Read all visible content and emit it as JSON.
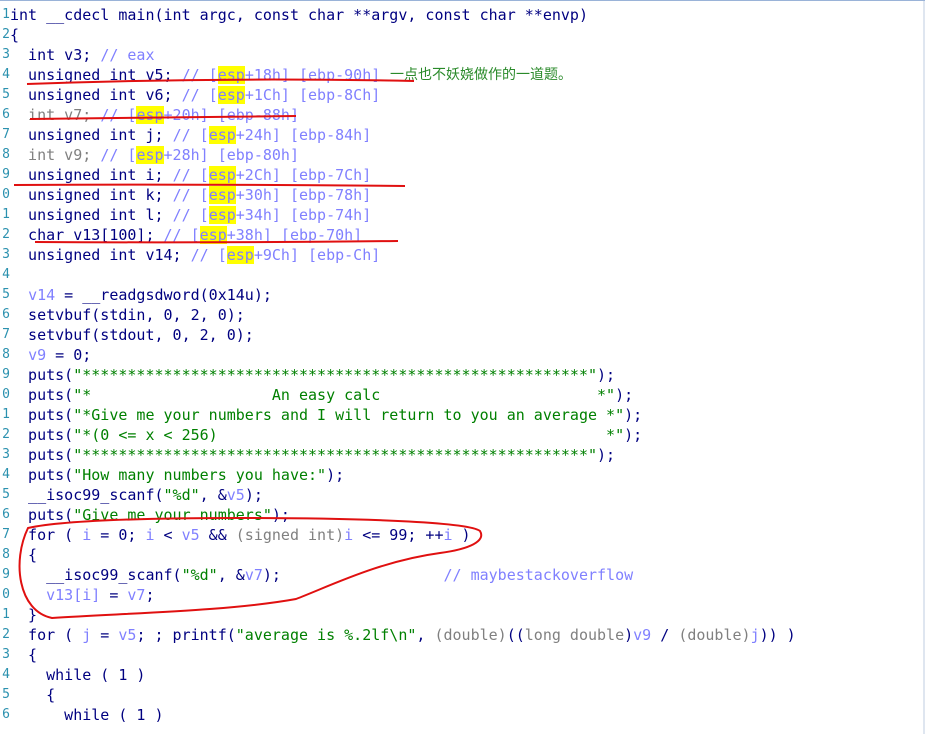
{
  "gutter": [
    "1",
    "2",
    "3",
    "4",
    "5",
    "6",
    "7",
    "8",
    "9",
    "0",
    "1",
    "2",
    "3",
    "4",
    "5",
    "6",
    "7",
    "8",
    "9",
    "0",
    "1",
    "2",
    "3",
    "4",
    "5",
    "6",
    "7",
    "8",
    "9",
    "0",
    "1",
    "2",
    "3",
    "4",
    "5",
    "6"
  ],
  "code": {
    "l1": "int __cdecl main(int argc, const char **argv, const char **envp)",
    "l2": "{",
    "l3a": "  int v3; ",
    "l3c": "// eax",
    "l4a": "  unsigned int v5; ",
    "l4c1": "// [",
    "l4h": "esp",
    "l4c2": "+18h] [ebp-90h]",
    "l5a": "  unsigned int v6; ",
    "l5c1": "// [",
    "l5h": "esp",
    "l5c2": "+1Ch] [ebp-8Ch]",
    "l6a": "  int v7; ",
    "l6c1": "// [",
    "l6h": "esp",
    "l6c2": "+20h] [ebp-88h]",
    "l7a": "  unsigned int j; ",
    "l7c1": "// [",
    "l7h": "esp",
    "l7c2": "+24h] [ebp-84h]",
    "l8a": "  int v9; ",
    "l8c1": "// [",
    "l8h": "esp",
    "l8c2": "+28h] [ebp-80h]",
    "l9a": "  unsigned int i; ",
    "l9c1": "// [",
    "l9h": "esp",
    "l9c2": "+2Ch] [ebp-7Ch]",
    "l10a": "  unsigned int k; ",
    "l10c1": "// [",
    "l10h": "esp",
    "l10c2": "+30h] [ebp-78h]",
    "l11a": "  unsigned int l; ",
    "l11c1": "// [",
    "l11h": "esp",
    "l11c2": "+34h] [ebp-74h]",
    "l12a": "  char v13[100]; ",
    "l12c1": "// [",
    "l12h": "esp",
    "l12c2": "+38h] [ebp-70h]",
    "l13a": "  unsigned int v14; ",
    "l13c1": "// [",
    "l13h": "esp",
    "l13c2": "+9Ch] [ebp-Ch]",
    "l15a": "  ",
    "l15v": "v14",
    "l15b": " = __readgsdword(0x14u);",
    "l16": "  setvbuf(stdin, 0, 2, 0);",
    "l17": "  setvbuf(stdout, 0, 2, 0);",
    "l18a": "  ",
    "l18v": "v9",
    "l18b": " = 0;",
    "l19a": "  puts(",
    "l19s": "\"********************************************************\"",
    "l19b": ");",
    "l20a": "  puts(",
    "l20s": "\"*                    An easy calc                        *\"",
    "l20b": ");",
    "l21a": "  puts(",
    "l21s": "\"*Give me your numbers and I will return to you an average *\"",
    "l21b": ");",
    "l22a": "  puts(",
    "l22s": "\"*(0 <= x < 256)                                           *\"",
    "l22b": ");",
    "l23a": "  puts(",
    "l23s": "\"********************************************************\"",
    "l23b": ");",
    "l24a": "  puts(",
    "l24s": "\"How many numbers you have:\"",
    "l24b": ");",
    "l25a": "  __isoc99_scanf(",
    "l25s": "\"%d\"",
    "l25b": ", &",
    "l25v": "v5",
    "l25c": ");",
    "l26a": "  puts(",
    "l26s": "\"Give me your numbers\"",
    "l26b": ");",
    "l27a": "  for ( ",
    "l27v1": "i",
    "l27b": " = 0; ",
    "l27v2": "i",
    "l27c": " < ",
    "l27v3": "v5",
    "l27d": " && ",
    "l27g": "(signed int)",
    "l27v4": "i",
    "l27e": " <= 99; ++",
    "l27v5": "i",
    "l27f": " )",
    "l28": "  {",
    "l29a": "    __isoc99_scanf(",
    "l29s": "\"%d\"",
    "l29b": ", &",
    "l29v": "v7",
    "l29c": ");",
    "l29sp": "                  ",
    "l29cm": "// maybestackoverflow",
    "l30a": "    ",
    "l30v1": "v13[i]",
    "l30b": " = ",
    "l30v2": "v7",
    "l30c": ";",
    "l31": "  }",
    "l32a": "  for ( ",
    "l32v1": "j",
    "l32b": " = ",
    "l32v2": "v5",
    "l32c": "; ; printf(",
    "l32s": "\"average is %.2lf\\n\"",
    "l32d": ", ",
    "l32g1": "(double)",
    "l32e": "((",
    "l32g2": "long double",
    "l32f": ")",
    "l32v3": "v9",
    "l32h": " / ",
    "l32g3": "(double)",
    "l32v4": "j",
    "l32i": ")) )",
    "l33": "  {",
    "l34": "    while ( 1 )",
    "l35": "    {",
    "l36": "      while ( 1 )"
  },
  "annotation_text": "一点也不妖娆做作的一道题。",
  "colors": {
    "keyword": "#000080",
    "comment": "#8080ff",
    "string": "#008000",
    "highlight": "#ffff00",
    "annotation_ink": "#e01010",
    "annotation_text": "#2a8a2a"
  }
}
